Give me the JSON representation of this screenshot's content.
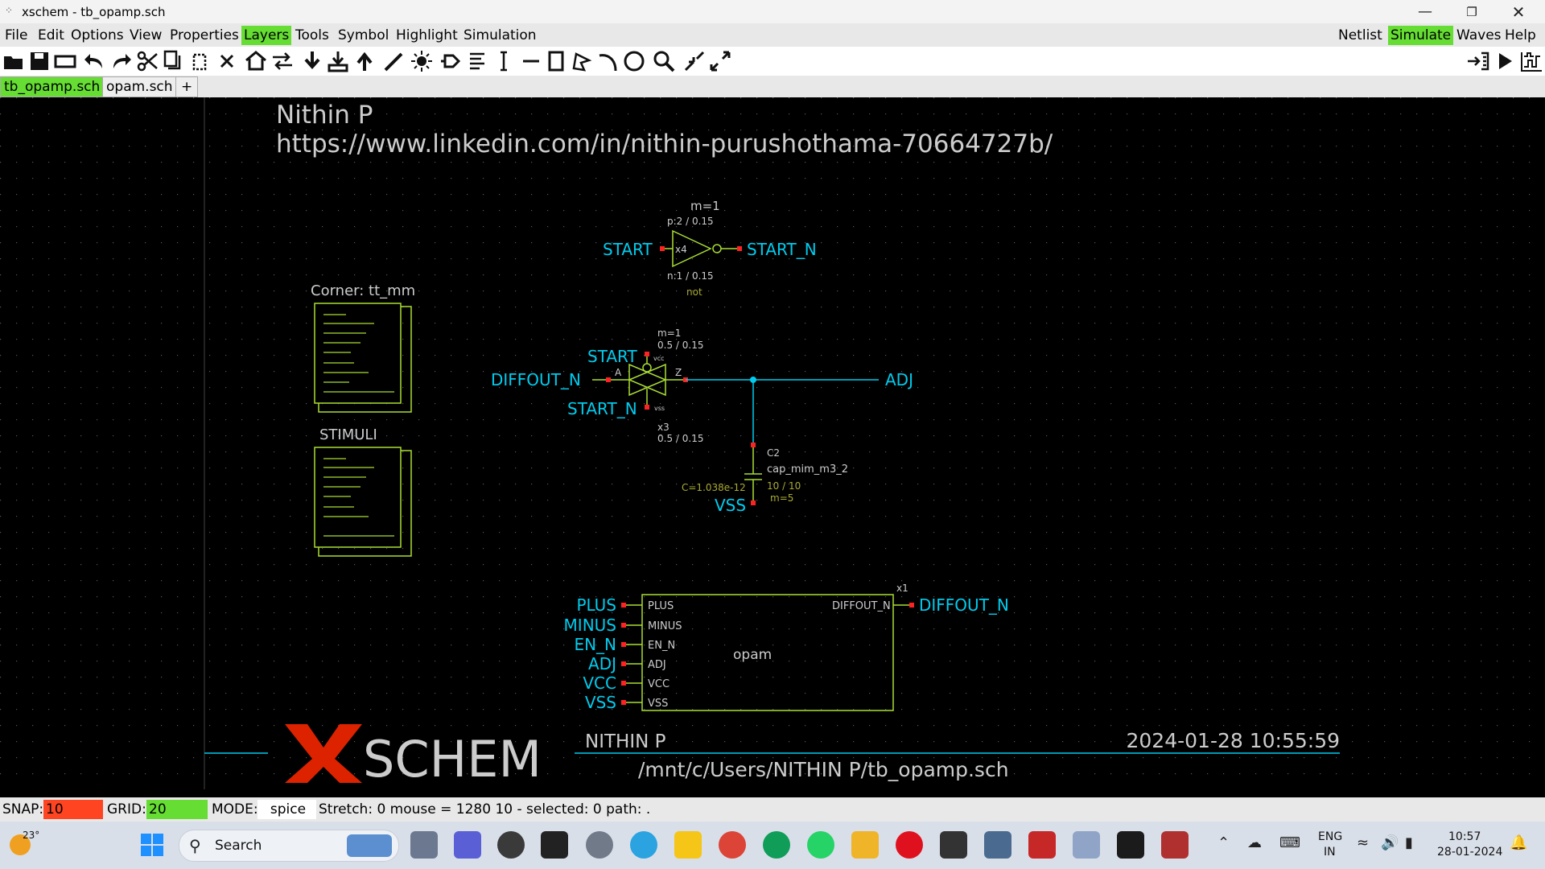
{
  "window": {
    "title": "xschem - tb_opamp.sch",
    "app_icon": "xschem-icon",
    "controls": [
      "minimize",
      "restore",
      "close"
    ]
  },
  "menus": [
    "File",
    "Edit",
    "Options",
    "View",
    "Properties",
    "Layers",
    "Tools",
    "Symbol",
    "Highlight",
    "Simulation"
  ],
  "menus_right": [
    "Netlist",
    "Simulate",
    "Waves",
    "Help"
  ],
  "highlighted_menus": [
    "Layers",
    "Simulate"
  ],
  "toolbar_icons": [
    "open-icon",
    "save-icon",
    "reload-icon",
    "undo-icon",
    "redo-icon",
    "cut-icon",
    "copy-icon",
    "duplicate-icon",
    "delete-icon",
    "home-icon",
    "swap-icon",
    "insert-symbol-icon",
    "push-icon",
    "pop-icon",
    "wire-icon",
    "highlight-icon",
    "net-label-icon",
    "text-icon",
    "pin-icon",
    "line-icon",
    "rect-icon",
    "polygon-icon",
    "arc-icon",
    "circle-icon",
    "zoom-icon",
    "zoom-in-icon",
    "zoom-full-icon",
    "netlist-icon",
    "run-icon",
    "waves-icon"
  ],
  "tabs": [
    {
      "label": "tb_opamp.sch",
      "active": true
    },
    {
      "label": "opam.sch",
      "active": false
    },
    {
      "label": "+"
    }
  ],
  "canvas": {
    "author": "Nithin P",
    "linkedin": "https://www.linkedin.com/in/nithin-purushothama-70664727b/",
    "corner_label": "Corner: tt_mm",
    "stimuli_label": "STIMULI",
    "inverter": {
      "m": "m=1",
      "p": "p:2 / 0.15",
      "inst": "x4",
      "n": "n:1 / 0.15",
      "type": "not",
      "in": "START",
      "out": "START_N"
    },
    "tgate": {
      "m": "m=1",
      "size_top": "0.5 / 0.15",
      "inst": "x3",
      "size_bottom": "0.5 / 0.15",
      "ctrl": "START",
      "ctrl_n": "START_N",
      "a": "A",
      "z": "Z",
      "vcc": "vcc",
      "vss": "vss",
      "in": "DIFFOUT_N",
      "out": "ADJ"
    },
    "cap": {
      "inst": "C2",
      "model": "cap_mim_m3_2",
      "value": "C=1.038e-12",
      "size": "10 / 10",
      "m": "m=5",
      "gnd": "VSS"
    },
    "opamp": {
      "inst": "x1",
      "name": "opam",
      "pins_left": [
        "PLUS",
        "MINUS",
        "EN_N",
        "ADJ",
        "VCC",
        "VSS"
      ],
      "pin_right": "DIFFOUT_N",
      "labels_left": [
        "PLUS",
        "MINUS",
        "EN_N",
        "ADJ",
        "VCC",
        "VSS"
      ],
      "label_right": "DIFFOUT_N"
    },
    "logo_x": "X",
    "logo_text": "SCHEM",
    "footer_author": "NITHIN P",
    "footer_date": "2024-01-28  10:55:59",
    "footer_path": "/mnt/c/Users/NITHIN P/tb_opamp.sch"
  },
  "status": {
    "snap_label": "SNAP:",
    "snap": "10",
    "grid_label": "GRID:",
    "grid": "20",
    "mode_label": "MODE:",
    "mode": "spice",
    "info": "Stretch: 0  mouse = 1280 10 - selected: 0 path: ."
  },
  "taskbar": {
    "weather": "23°",
    "search": "Search",
    "lang": "ENG",
    "region": "IN",
    "time": "10:57",
    "date": "28-01-2024"
  },
  "colors": {
    "wire": "#00ccee",
    "label": "#00ccee",
    "component": "#aadd33",
    "pin": "#ff2222",
    "text": "#cccccc",
    "menu_highlight": "#66dd33",
    "logo_red": "#dd2200"
  }
}
